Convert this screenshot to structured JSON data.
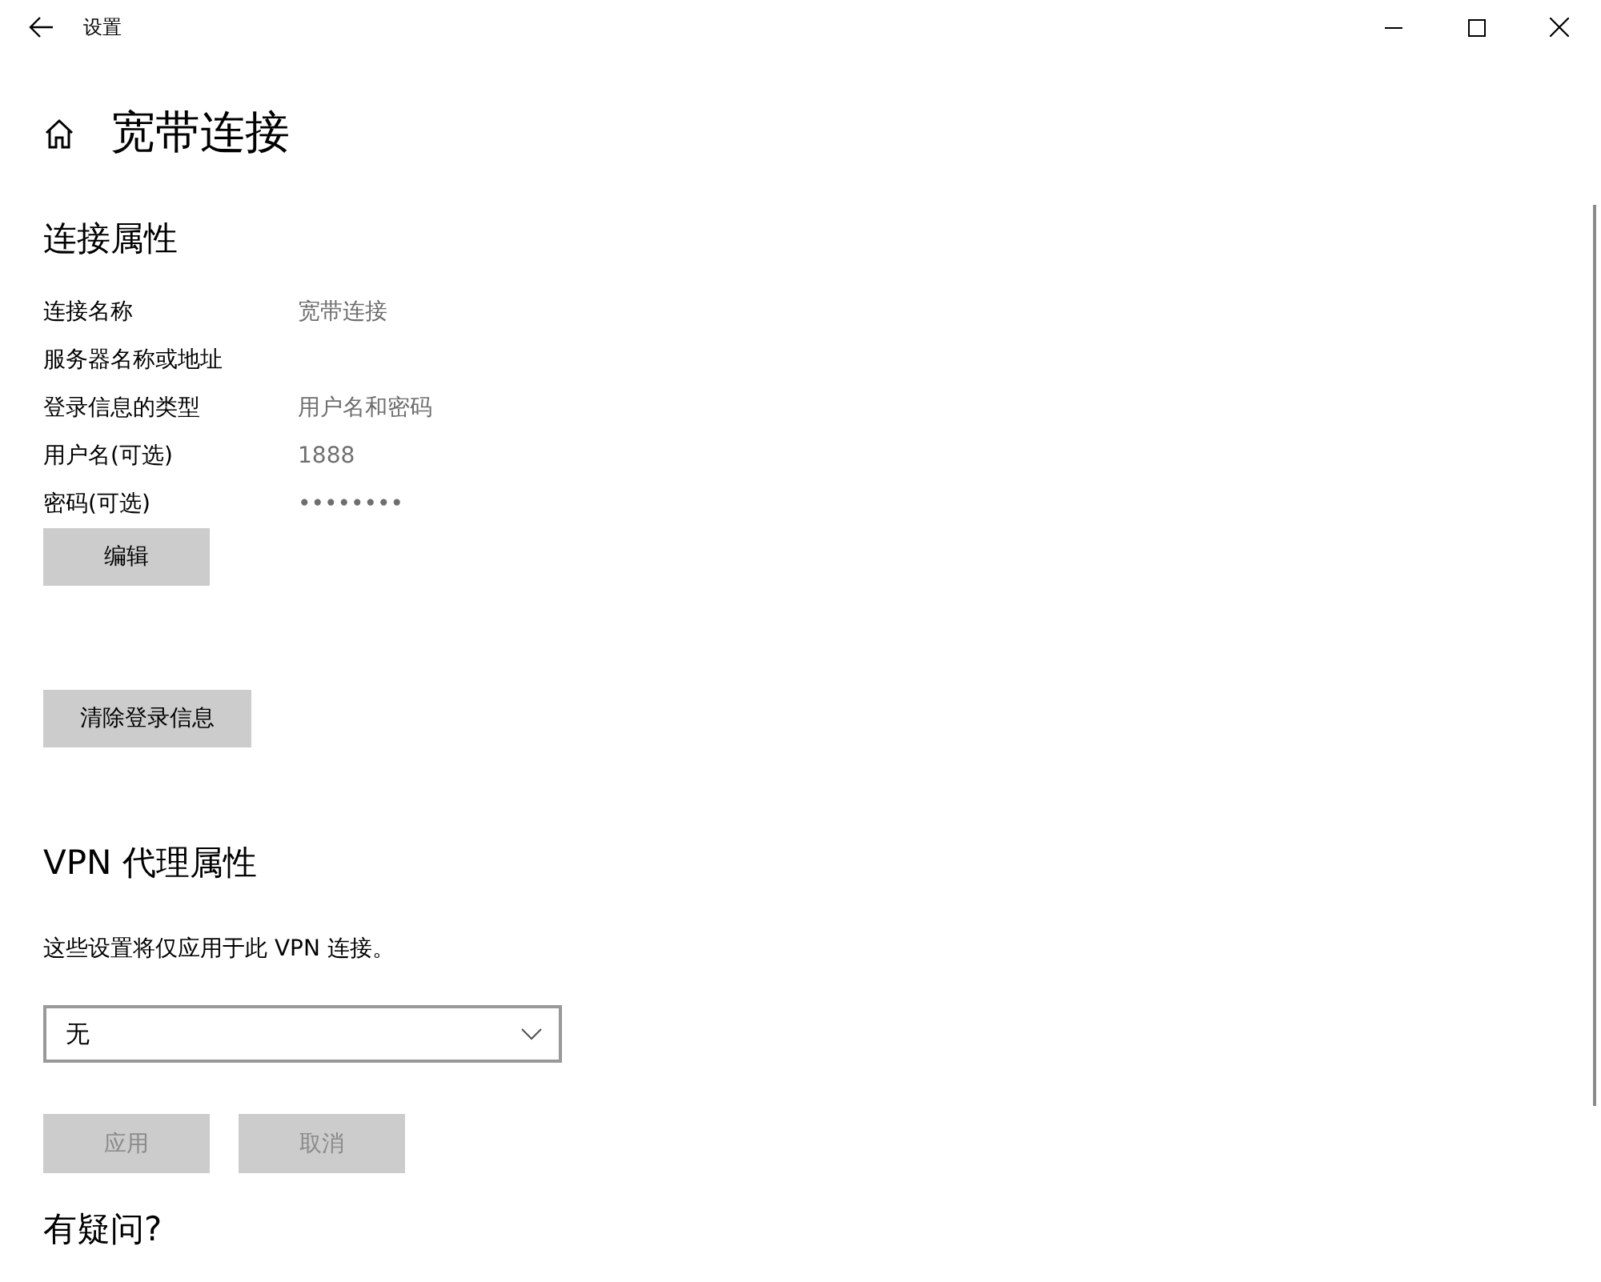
{
  "window": {
    "title": "设置"
  },
  "page_title": "宽带连接",
  "connection_properties": {
    "heading": "连接属性",
    "rows": [
      {
        "label": "连接名称",
        "value": "宽带连接"
      },
      {
        "label": "服务器名称或地址"
      },
      {
        "label": "登录信息的类型",
        "value": "用户名和密码"
      },
      {
        "label": "用户名(可选)",
        "value": "1888"
      },
      {
        "label": "密码(可选)",
        "value": "••••••••"
      }
    ],
    "edit_button": {
      "label": "编辑",
      "disabled": false
    },
    "clear_button": {
      "label": "清除登录信息",
      "disabled": false
    }
  },
  "vpn_proxy": {
    "heading": "VPN 代理属性",
    "description": "这些设置将仅应用于此 VPN 连接。",
    "dropdown": {
      "value": "无"
    },
    "buttons": [
      {
        "label": "应用",
        "disabled": true
      },
      {
        "label": "取消",
        "disabled": true
      }
    ]
  },
  "help_heading": "有疑问?"
}
